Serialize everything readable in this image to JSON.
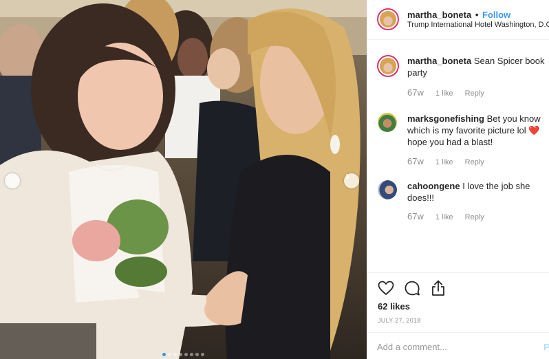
{
  "post": {
    "username": "martha_boneta",
    "separator": "•",
    "follow_label": "Follow",
    "location": "Trump International Hotel Washington, D.C.",
    "likes": "62 likes",
    "date": "JULY 27, 2018",
    "comment_placeholder": "Add a comment...",
    "post_label": "Post",
    "carousel_count": 8,
    "carousel_active": 1
  },
  "comments": [
    {
      "user": "martha_boneta",
      "text": "Sean Spicer book party",
      "heart": "",
      "text2": "",
      "time": "67w",
      "likes": "1 like",
      "reply": "Reply"
    },
    {
      "user": "marksgonefishing",
      "text": "Bet you know which is my favorite picture lol",
      "heart": "❤️",
      "text2": "hope you had a blast!",
      "time": "67w",
      "likes": "1 like",
      "reply": "Reply"
    },
    {
      "user": "cahoongene",
      "text": "I love the job she does!!!",
      "heart": "",
      "text2": "",
      "time": "67w",
      "likes": "1 like",
      "reply": "Reply"
    }
  ],
  "icons": {
    "like": "heart-outline-icon",
    "comment": "speech-bubble-icon",
    "share": "share-upload-icon",
    "prev": "chevron-left-icon",
    "next": "chevron-right-icon"
  },
  "colors": {
    "accent": "#3897f0",
    "heart": "#ed4956",
    "ring": "#e1306c",
    "muted": "#8e8e8e"
  }
}
